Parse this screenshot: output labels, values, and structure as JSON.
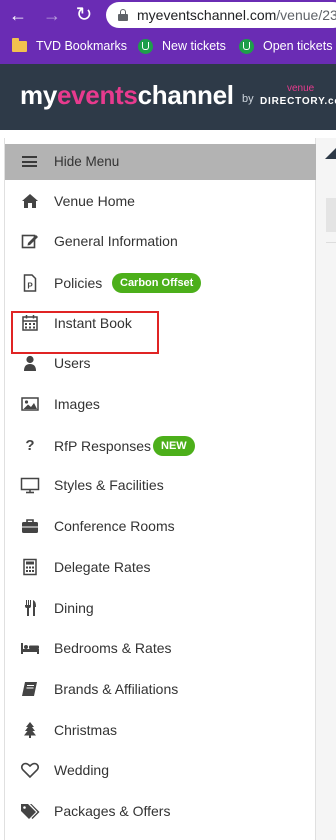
{
  "browser": {
    "url_host": "myeventschannel.com",
    "url_path": "/venue/23",
    "bookmarks": [
      {
        "label": "TVD Bookmarks",
        "icon": "folder-icon"
      },
      {
        "label": "New tickets",
        "icon": "ticket-site-icon"
      },
      {
        "label": "Open tickets",
        "icon": "ticket-site-icon"
      }
    ]
  },
  "header": {
    "logo_part1": "my",
    "logo_part2": "events",
    "logo_part3": "channel",
    "logo_by": "by",
    "logo_venue": "venue",
    "logo_directory": "DIRECTORY.com"
  },
  "sidebar": {
    "hide_menu_label": "Hide Menu",
    "items": [
      {
        "label": "Venue Home",
        "icon": "home-icon"
      },
      {
        "label": "General Information",
        "icon": "edit-icon"
      },
      {
        "label": "Policies",
        "icon": "policy-document-icon",
        "badge": "Carbon Offset"
      },
      {
        "label": "Instant Book",
        "icon": "calendar-icon"
      },
      {
        "label": "Users",
        "icon": "user-icon"
      },
      {
        "label": "Images",
        "icon": "image-icon"
      },
      {
        "label": "RfP Responses",
        "icon": "question-icon",
        "badge": "NEW"
      },
      {
        "label": "Styles & Facilities",
        "icon": "monitor-icon"
      },
      {
        "label": "Conference Rooms",
        "icon": "briefcase-icon"
      },
      {
        "label": "Delegate Rates",
        "icon": "calculator-icon"
      },
      {
        "label": "Dining",
        "icon": "cutlery-icon"
      },
      {
        "label": "Bedrooms & Rates",
        "icon": "bed-icon"
      },
      {
        "label": "Brands & Affiliations",
        "icon": "book-icon"
      },
      {
        "label": "Christmas",
        "icon": "tree-icon"
      },
      {
        "label": "Wedding",
        "icon": "heart-icon"
      },
      {
        "label": "Packages & Offers",
        "icon": "tags-icon"
      }
    ]
  },
  "colors": {
    "browser_chrome": "#6a2cb4",
    "site_header": "#2e3a48",
    "brand_pink": "#e83a8e",
    "badge_green": "#4caf1a",
    "highlight_red": "#e02424",
    "hide_menu_bg": "#b3b3b3"
  }
}
